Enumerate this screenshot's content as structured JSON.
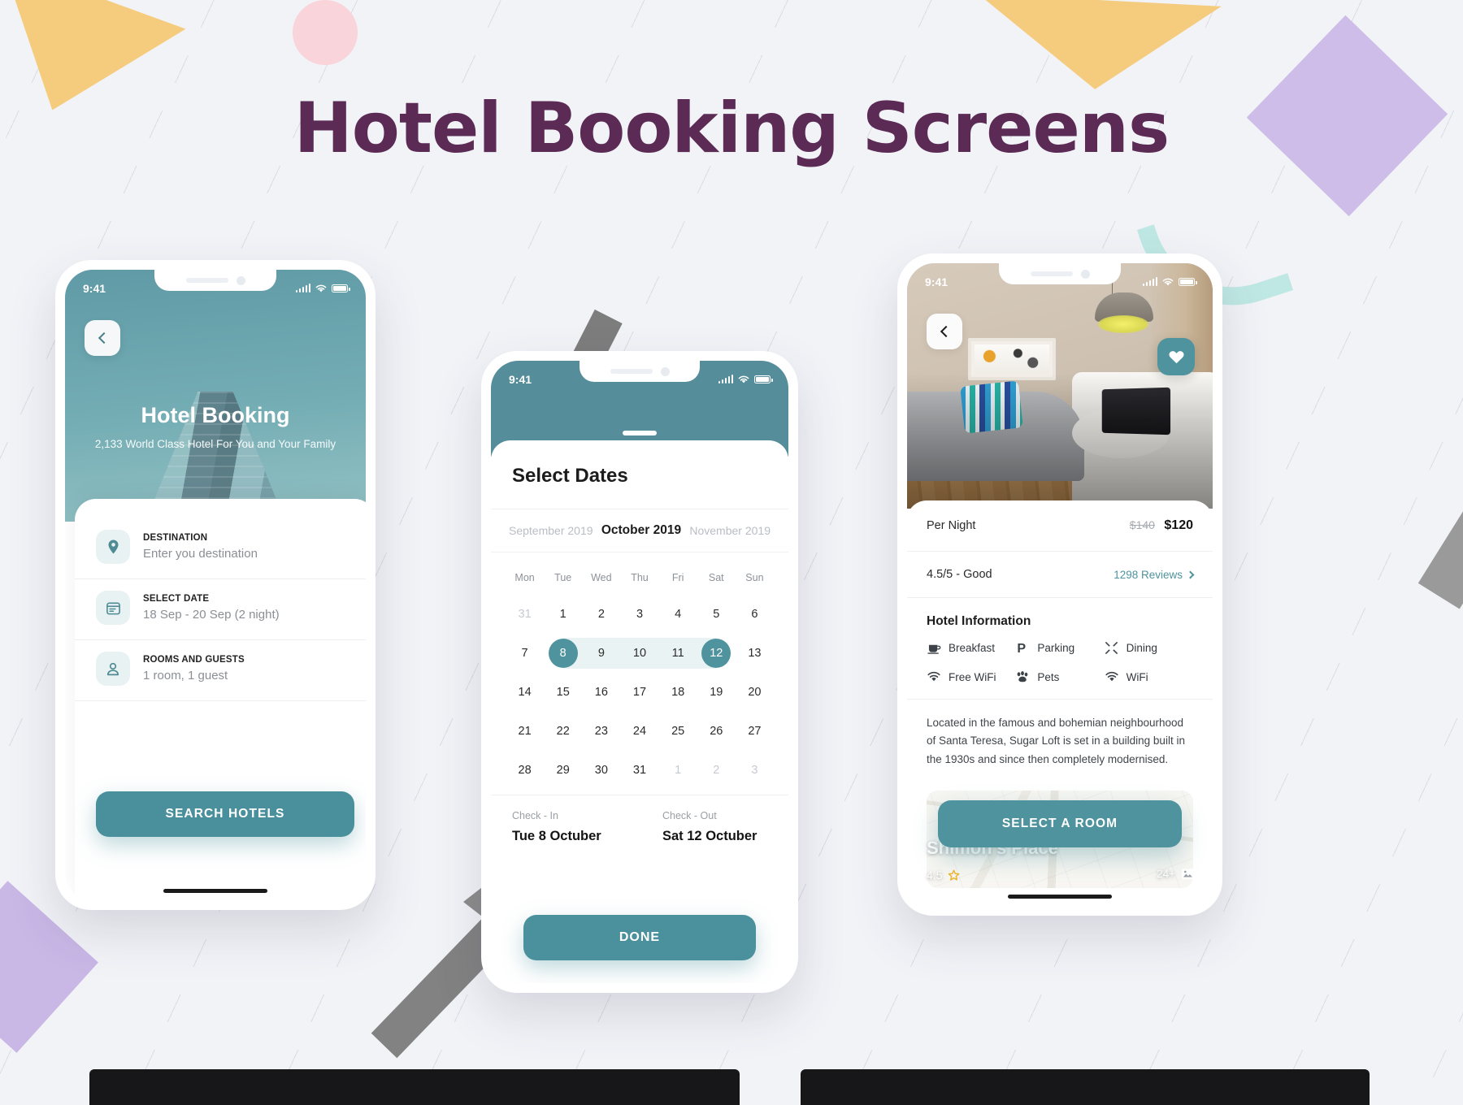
{
  "page": {
    "title": "Hotel Booking Screens"
  },
  "phone1": {
    "status": {
      "time": "9:41"
    },
    "back_icon": "chevron-left-icon",
    "hero": {
      "title": "Hotel Booking",
      "subtitle": "2,133 World Class Hotel For You and Your Family"
    },
    "fields": [
      {
        "icon": "location-pin-icon",
        "label": "DESTINATION",
        "value": "Enter you destination"
      },
      {
        "icon": "calendar-icon",
        "label": "SELECT DATE",
        "value": "18 Sep - 20 Sep (2 night)"
      },
      {
        "icon": "person-icon",
        "label": "ROOMS AND GUESTS",
        "value": "1 room, 1 guest"
      }
    ],
    "search_button": "SEARCH HOTELS"
  },
  "phone2": {
    "status": {
      "time": "9:41"
    },
    "heading": "Select Dates",
    "months": {
      "prev": "September 2019",
      "current": "October 2019",
      "next": "November 2019"
    },
    "weekdays": [
      "Mon",
      "Tue",
      "Wed",
      "Thu",
      "Fri",
      "Sat",
      "Sun"
    ],
    "days": [
      [
        {
          "d": "31",
          "m": true
        },
        {
          "d": "1"
        },
        {
          "d": "2"
        },
        {
          "d": "3"
        },
        {
          "d": "4"
        },
        {
          "d": "5"
        },
        {
          "d": "6"
        }
      ],
      [
        {
          "d": "7"
        },
        {
          "d": "8",
          "sel": true,
          "start": true
        },
        {
          "d": "9",
          "in": true
        },
        {
          "d": "10",
          "in": true
        },
        {
          "d": "11",
          "in": true
        },
        {
          "d": "12",
          "sel": true,
          "end": true
        },
        {
          "d": "13"
        }
      ],
      [
        {
          "d": "14"
        },
        {
          "d": "15"
        },
        {
          "d": "16"
        },
        {
          "d": "17"
        },
        {
          "d": "18"
        },
        {
          "d": "19"
        },
        {
          "d": "20"
        }
      ],
      [
        {
          "d": "21"
        },
        {
          "d": "22"
        },
        {
          "d": "23"
        },
        {
          "d": "24"
        },
        {
          "d": "25"
        },
        {
          "d": "26"
        },
        {
          "d": "27"
        }
      ],
      [
        {
          "d": "28"
        },
        {
          "d": "29"
        },
        {
          "d": "30"
        },
        {
          "d": "31"
        },
        {
          "d": "1",
          "m": true
        },
        {
          "d": "2",
          "m": true
        },
        {
          "d": "3",
          "m": true
        }
      ]
    ],
    "checkin": {
      "label": "Check - In",
      "value": "Tue 8 Octuber"
    },
    "checkout": {
      "label": "Check - Out",
      "value": "Sat 12 Octuber"
    },
    "done_button": "DONE"
  },
  "phone3": {
    "status": {
      "time": "9:41"
    },
    "back_icon": "chevron-left-icon",
    "favorite_icon": "heart-icon",
    "hotel": {
      "name": "Shimon’s Place",
      "rating": "4.5",
      "star_icon": "star-icon",
      "photo_count": "24+",
      "photo_icon": "image-icon"
    },
    "price": {
      "label": "Per Night",
      "old": "$140",
      "new": "$120"
    },
    "reviews": {
      "score": "4.5/5 - Good",
      "link": "1298 Reviews",
      "chevron_icon": "chevron-right-icon"
    },
    "info_heading": "Hotel Information",
    "amenities": [
      {
        "icon": "coffee-icon",
        "label": "Breakfast"
      },
      {
        "icon": "parking-icon",
        "label": "Parking"
      },
      {
        "icon": "dining-icon",
        "label": "Dining"
      },
      {
        "icon": "wifi-icon",
        "label": "Free WiFi"
      },
      {
        "icon": "pets-icon",
        "label": "Pets"
      },
      {
        "icon": "wifi-icon",
        "label": "WiFi"
      }
    ],
    "description": "Located in the famous and bohemian neighbourhood of Santa Teresa, Sugar Loft is set in a building built in the 1930s and since then completely modernised.",
    "select_button": "SELECT A ROOM"
  }
}
